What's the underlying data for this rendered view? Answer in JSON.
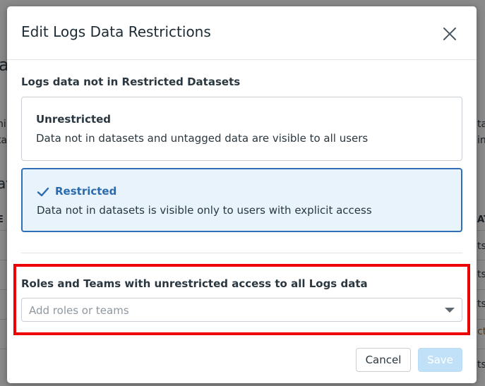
{
  "background": {
    "fragments": [
      "a",
      "ni",
      "ta",
      "at",
      "ta",
      "ts",
      "ts",
      "cti",
      "ts",
      "inf",
      "E",
      "AT"
    ]
  },
  "modal": {
    "title": "Edit Logs Data Restrictions",
    "close_icon": "close-icon",
    "section_title": "Logs data not in Restricted Datasets",
    "options": [
      {
        "title": "Unrestricted",
        "description": "Data not in datasets and untagged data are visible to all users",
        "selected": false
      },
      {
        "title": "Restricted",
        "description": "Data not in datasets is visible only to users with explicit access",
        "selected": true,
        "icon": "checkmark-icon"
      }
    ],
    "roles": {
      "label": "Roles and Teams with unrestricted access to all Logs data",
      "placeholder": "Add roles or teams",
      "dropdown_icon": "caret-down-icon"
    },
    "footer": {
      "cancel_label": "Cancel",
      "save_label": "Save",
      "save_enabled": false
    }
  },
  "colors": {
    "accent": "#2f6fb6",
    "selected_bg": "#e8f3fb",
    "highlight": "#ee0000",
    "save_disabled": "#c0e1f7"
  }
}
